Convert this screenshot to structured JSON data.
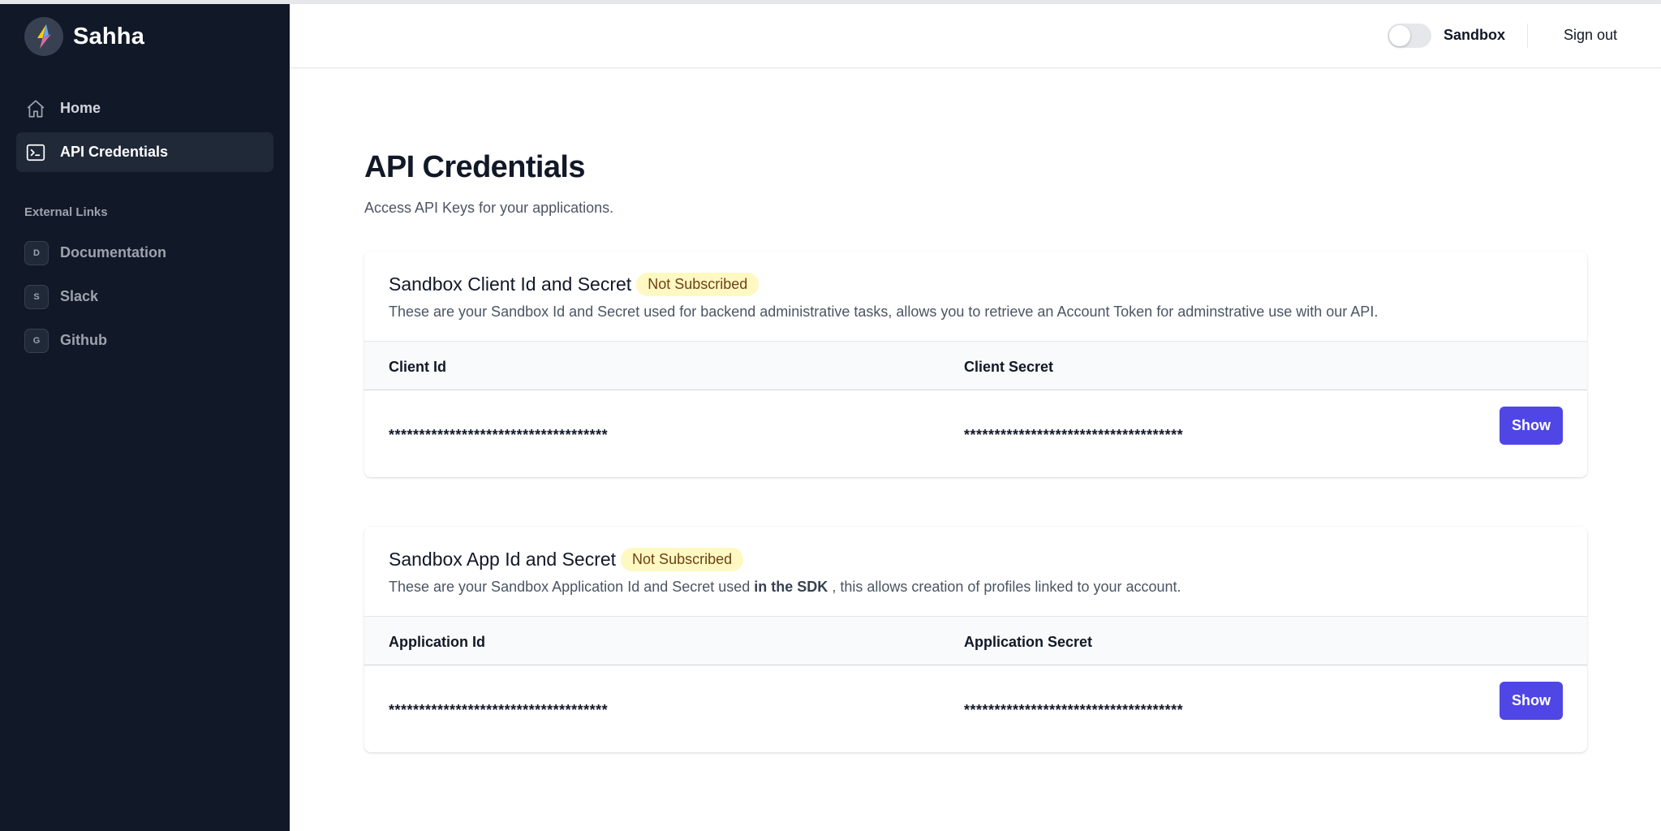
{
  "app": {
    "brand": "Sahha"
  },
  "header": {
    "toggle_label": "Sandbox",
    "signout_label": "Sign out"
  },
  "sidebar": {
    "nav": [
      {
        "label": "Home",
        "icon": "home-icon",
        "active": false
      },
      {
        "label": "API Credentials",
        "icon": "terminal-icon",
        "active": true
      }
    ],
    "external_label": "External Links",
    "external": [
      {
        "badge": "D",
        "label": "Documentation"
      },
      {
        "badge": "S",
        "label": "Slack"
      },
      {
        "badge": "G",
        "label": "Github"
      }
    ]
  },
  "main": {
    "title": "API Credentials",
    "subtitle": "Access API Keys for your applications.",
    "cards": [
      {
        "title": "Sandbox Client Id and Secret",
        "badge": "Not Subscribed",
        "desc": "These are your Sandbox Id and Secret used for backend administrative tasks, allows you to retrieve an Account Token for adminstrative use with our API.",
        "col1": "Client Id",
        "col2": "Client Secret",
        "val1": "************************************",
        "val2": "************************************",
        "button": "Show"
      },
      {
        "title": "Sandbox App Id and Secret",
        "badge": "Not Subscribed",
        "desc_pre": "These are your Sandbox Application Id and Secret used ",
        "desc_bold": "in the SDK",
        "desc_post": " , this allows creation of profiles linked to your account.",
        "col1": "Application Id",
        "col2": "Application Secret",
        "val1": "************************************",
        "val2": "************************************",
        "button": "Show"
      }
    ]
  },
  "colors": {
    "sidebar_bg": "#111827",
    "accent": "#4f46e5",
    "badge_bg": "#fef9c3"
  }
}
